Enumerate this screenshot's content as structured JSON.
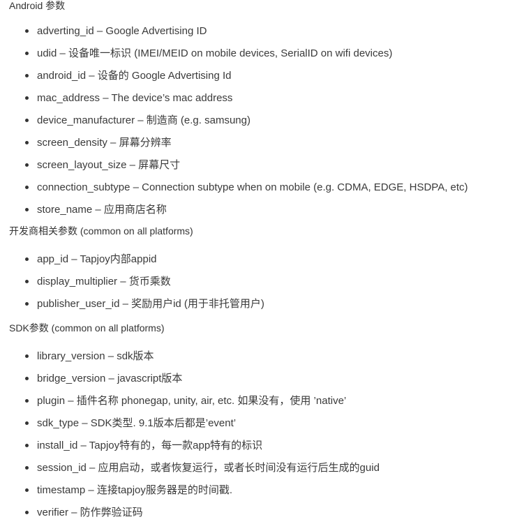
{
  "sections": [
    {
      "title": "Android 参数",
      "items": [
        "adverting_id – Google Advertising ID",
        "udid – 设备唯一标识 (IMEI/MEID on mobile devices, SerialID on wifi devices)",
        "android_id – 设备的 Google Advertising Id",
        "mac_address – The device’s mac address",
        "device_manufacturer – 制造商 (e.g. samsung)",
        "screen_density – 屏幕分辨率",
        "screen_layout_size – 屏幕尺寸",
        "connection_subtype – Connection subtype when on mobile (e.g. CDMA, EDGE, HSDPA, etc)",
        "store_name – 应用商店名称"
      ]
    },
    {
      "title": "开发商相关参数 (common on all platforms)",
      "items": [
        "app_id – Tapjoy内部appid",
        "display_multiplier – 货币乘数",
        "publisher_user_id – 奖励用户id (用于非托管用户)"
      ]
    },
    {
      "title": "SDK参数 (common on all platforms)",
      "items": [
        "library_version – sdk版本",
        "bridge_version – javascript版本",
        "plugin – 插件名称 phonegap, unity, air, etc. 如果没有，使用 ’native’",
        "sdk_type – SDK类型. 9.1版本后都是’event’",
        "install_id – Tapjoy特有的，每一款app特有的标识",
        "session_id – 应用启动，或者恢复运行，或者长时间没有运行后生成的guid",
        "timestamp – 连接tapjoy服务器是的时间戳.",
        "verifier – 防作弊验证码"
      ]
    }
  ]
}
